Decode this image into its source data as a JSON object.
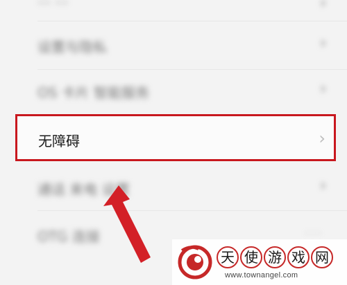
{
  "settings_list": {
    "items": [
      {
        "label": "··· ···",
        "blurred": true
      },
      {
        "label": "设置与隐私",
        "blurred": true
      },
      {
        "label": "OS 卡片 智能服务",
        "blurred": true
      },
      {
        "label": "无障碍",
        "blurred": false,
        "highlighted": true
      },
      {
        "label": "通话 来电 设置",
        "blurred": true
      },
      {
        "label": "OTG 连接",
        "value": "· · ·",
        "blurred": true
      }
    ],
    "chevron": "›"
  },
  "annotation": {
    "highlight_color": "#c8171e",
    "arrow_color": "#d32027"
  },
  "watermark": {
    "title_chars": [
      "天",
      "使",
      "游",
      "戏",
      "网"
    ],
    "url": "www.townangel.com",
    "brand_color": "#c62828"
  }
}
